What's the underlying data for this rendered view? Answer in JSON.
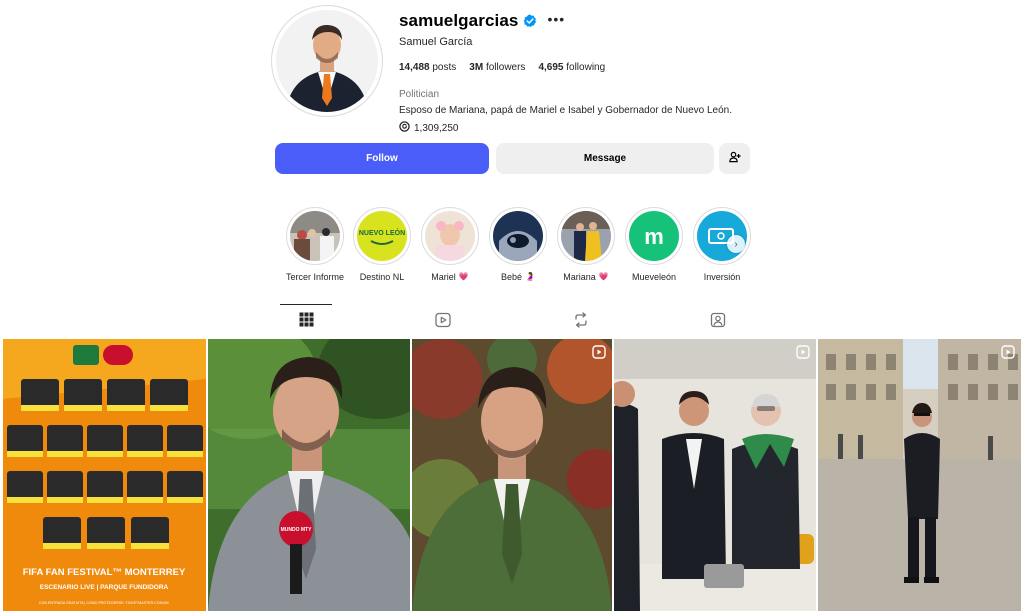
{
  "profile": {
    "username": "samuelgarcias",
    "verified": true,
    "full_name": "Samuel García",
    "posts_count": "14,488",
    "posts_label": "posts",
    "followers_count": "3M",
    "followers_label": "followers",
    "following_count": "4,695",
    "following_label": "following",
    "category": "Politician",
    "bio": "Esposo de Mariana, papá de Mariel e Isabel y Gobernador de Nuevo León.",
    "threads_count": "1,309,250"
  },
  "actions": {
    "follow_label": "Follow",
    "message_label": "Message",
    "suggest_icon": "add-person-icon"
  },
  "highlights": [
    {
      "label": "Tercer Informe",
      "emoji": ""
    },
    {
      "label": "Destino NL",
      "emoji": ""
    },
    {
      "label": "Mariel",
      "emoji": "💗"
    },
    {
      "label": "Bebé",
      "emoji": "🤰"
    },
    {
      "label": "Mariana",
      "emoji": "💗"
    },
    {
      "label": "Mueveleón",
      "emoji": ""
    },
    {
      "label": "Inversión",
      "emoji": ""
    }
  ],
  "highlight_texts": {
    "destino": "NUEVO LEÓN",
    "mueveleon": "m"
  },
  "tabs": [
    "posts-grid-icon",
    "reels-icon",
    "reposts-icon",
    "tagged-icon"
  ],
  "posts": {
    "poster": {
      "headline_1": "FIFA FAN FESTIVAL™ MONTERREY",
      "headline_2": "ESCENARIO LIVE | PARQUE FUNDIDORA",
      "footer": "CON ENTRADA GRATUITA | COMO PROTEGERSE: TICKETMASTER.COM.MX"
    },
    "mic_label": "MUNDO MTY"
  },
  "colors": {
    "follow_blue": "#4a5df9",
    "verified_blue": "#0095f6",
    "poster_orange": "#f08a0c",
    "mueveleon_green": "#16c27a",
    "destino_yellow": "#d8e21e",
    "inversion_cyan": "#17a9d9"
  }
}
